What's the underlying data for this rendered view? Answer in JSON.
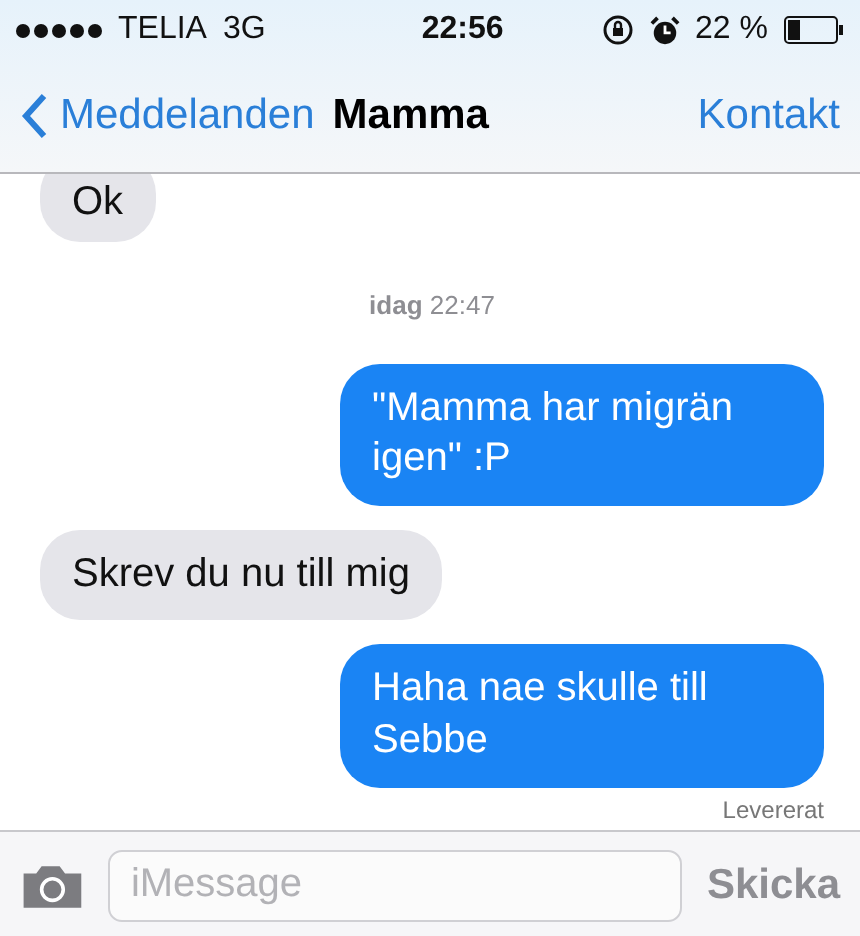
{
  "status_bar": {
    "carrier": "TELIA",
    "network": "3G",
    "time": "22:56",
    "battery": "22 %"
  },
  "nav": {
    "back": "Meddelanden",
    "title": "Mamma",
    "action": "Kontakt"
  },
  "messages": [
    {
      "kind": "incoming",
      "text": "Ok"
    },
    {
      "kind": "timestamp",
      "text": "**idag** 22:47"
    },
    {
      "kind": "outgoing",
      "text": "\"Mamma har migrän igen\" :P"
    },
    {
      "kind": "incoming",
      "text": "Skrev du nu till mig"
    },
    {
      "kind": "outgoing",
      "text": "Haha nae skulle till Sebbe"
    },
    {
      "kind": "status",
      "text": "Levererat"
    }
  ],
  "composer": {
    "placeholder": "iMessage",
    "send": "Skicka"
  }
}
